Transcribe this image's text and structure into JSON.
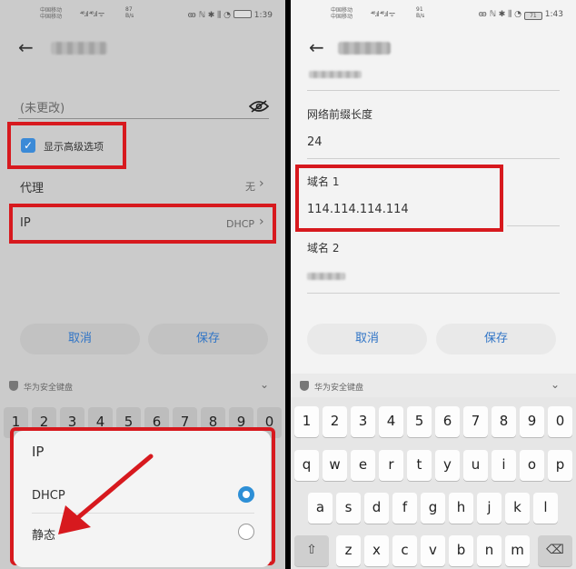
{
  "left": {
    "status": {
      "carrier1": "中国移动",
      "carrier2": "中国移动",
      "speed_value": "87",
      "speed_unit": "B/s",
      "battery": "",
      "time": "1:39"
    },
    "password_placeholder": "(未更改)",
    "show_advanced_label": "显示高级选项",
    "proxy": {
      "label": "代理",
      "value": "无"
    },
    "ip": {
      "label": "IP",
      "value": "DHCP"
    },
    "cancel": "取消",
    "save": "保存",
    "keyboard_label": "华为安全键盘",
    "number_keys": [
      "1",
      "2",
      "3",
      "4",
      "5",
      "6",
      "7",
      "8",
      "9",
      "0"
    ],
    "dialog": {
      "title": "IP",
      "options": [
        {
          "label": "DHCP",
          "selected": true
        },
        {
          "label": "静态",
          "selected": false
        }
      ]
    }
  },
  "right": {
    "status": {
      "carrier1": "中国移动",
      "carrier2": "中国移动",
      "speed_value": "91",
      "speed_unit": "B/s",
      "battery": "71",
      "time": "1:43"
    },
    "prefix_length": {
      "label": "网络前缀长度",
      "value": "24"
    },
    "dns1": {
      "label": "域名 1",
      "value": "114.114.114.114"
    },
    "dns2": {
      "label": "域名 2"
    },
    "cancel": "取消",
    "save": "保存",
    "keyboard_label": "华为安全键盘",
    "number_keys": [
      "1",
      "2",
      "3",
      "4",
      "5",
      "6",
      "7",
      "8",
      "9",
      "0"
    ],
    "row_q": [
      "q",
      "w",
      "e",
      "r",
      "t",
      "y",
      "u",
      "i",
      "o",
      "p"
    ],
    "row_a": [
      "a",
      "s",
      "d",
      "f",
      "g",
      "h",
      "j",
      "k",
      "l"
    ],
    "row_z": [
      "z",
      "x",
      "c",
      "v",
      "b",
      "n",
      "m"
    ],
    "shift_glyph": "⇧",
    "delete_glyph": "⌫"
  },
  "colors": {
    "highlight": "#d7191e",
    "accent": "#2f74c6",
    "radio": "#2d8fd6"
  }
}
